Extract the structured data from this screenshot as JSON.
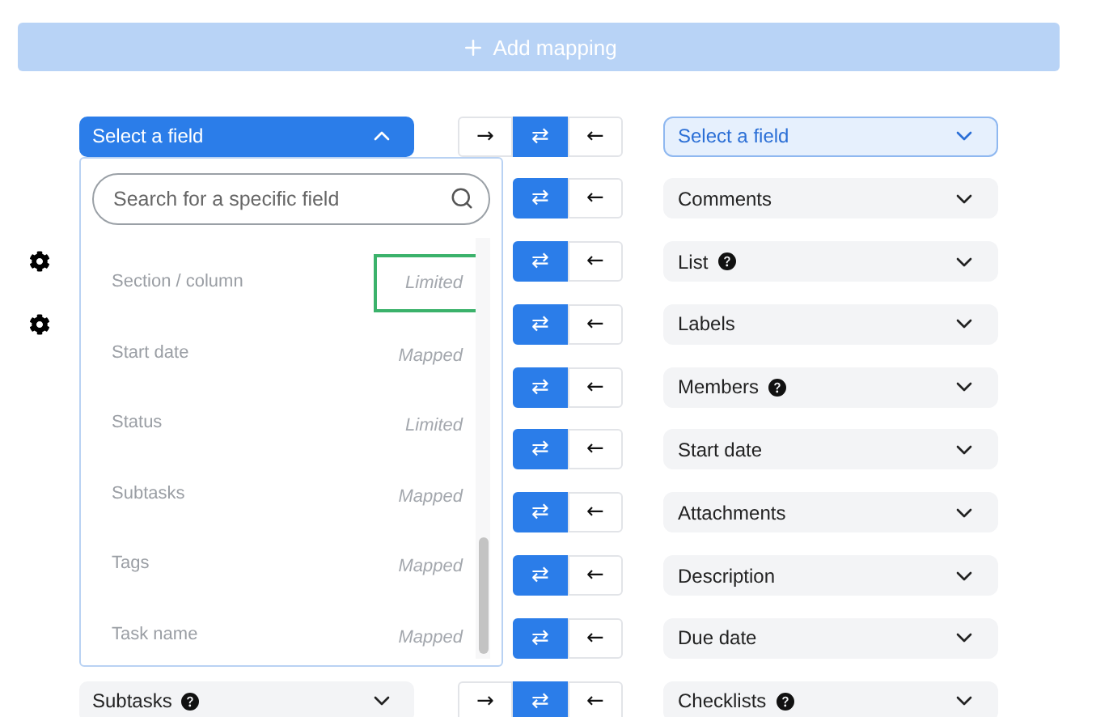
{
  "add_button": {
    "label": "Add mapping",
    "disabled": true
  },
  "rows": [
    {
      "gear": false,
      "left": {
        "label": "Select a field",
        "help": false,
        "open": true
      },
      "directions": [
        {
          "symbol": "→",
          "selected": false
        },
        {
          "symbol": "⇄",
          "selected": true
        },
        {
          "symbol": "←",
          "selected": false
        }
      ],
      "right": {
        "label": "Select a field",
        "help": false,
        "selected": true
      }
    },
    {
      "gear": false,
      "left": null,
      "directions": [
        {
          "symbol": "⇄",
          "selected": true
        },
        {
          "symbol": "←",
          "selected": false
        }
      ],
      "right": {
        "label": "Comments",
        "help": false,
        "selected": false
      }
    },
    {
      "gear": true,
      "left": null,
      "directions": [
        {
          "symbol": "⇄",
          "selected": true
        },
        {
          "symbol": "←",
          "selected": false
        }
      ],
      "right": {
        "label": "List",
        "help": true,
        "selected": false
      }
    },
    {
      "gear": true,
      "left": null,
      "directions": [
        {
          "symbol": "⇄",
          "selected": true
        },
        {
          "symbol": "←",
          "selected": false
        }
      ],
      "right": {
        "label": "Labels",
        "help": false,
        "selected": false
      }
    },
    {
      "gear": false,
      "left": null,
      "directions": [
        {
          "symbol": "⇄",
          "selected": true
        },
        {
          "symbol": "←",
          "selected": false
        }
      ],
      "right": {
        "label": "Members",
        "help": true,
        "selected": false
      }
    },
    {
      "gear": false,
      "left": null,
      "directions": [
        {
          "symbol": "⇄",
          "selected": true
        },
        {
          "symbol": "←",
          "selected": false
        }
      ],
      "right": {
        "label": "Start date",
        "help": false,
        "selected": false
      }
    },
    {
      "gear": false,
      "left": null,
      "directions": [
        {
          "symbol": "⇄",
          "selected": true
        },
        {
          "symbol": "←",
          "selected": false
        }
      ],
      "right": {
        "label": "Attachments",
        "help": false,
        "selected": false
      }
    },
    {
      "gear": false,
      "left": null,
      "directions": [
        {
          "symbol": "⇄",
          "selected": true
        },
        {
          "symbol": "←",
          "selected": false
        }
      ],
      "right": {
        "label": "Description",
        "help": false,
        "selected": false
      }
    },
    {
      "gear": false,
      "left": null,
      "directions": [
        {
          "symbol": "⇄",
          "selected": true
        },
        {
          "symbol": "←",
          "selected": false
        }
      ],
      "right": {
        "label": "Due date",
        "help": false,
        "selected": false
      }
    },
    {
      "gear": false,
      "left": {
        "label": "Subtasks",
        "help": true,
        "open": false
      },
      "directions": [
        {
          "symbol": "→",
          "selected": false
        },
        {
          "symbol": "⇄",
          "selected": true
        },
        {
          "symbol": "←",
          "selected": false
        }
      ],
      "right": {
        "label": "Checklists",
        "help": true,
        "selected": false
      }
    }
  ],
  "dropdown": {
    "search": {
      "placeholder": "Search for a specific field"
    },
    "items": [
      {
        "name": "Section / column",
        "status": "Limited",
        "outlined": true
      },
      {
        "name": "Start date",
        "status": "Mapped",
        "outlined": false
      },
      {
        "name": "Status",
        "status": "Limited",
        "outlined": false
      },
      {
        "name": "Subtasks",
        "status": "Mapped",
        "outlined": false
      },
      {
        "name": "Tags",
        "status": "Mapped",
        "outlined": false
      },
      {
        "name": "Task name",
        "status": "Mapped",
        "outlined": false
      }
    ]
  }
}
